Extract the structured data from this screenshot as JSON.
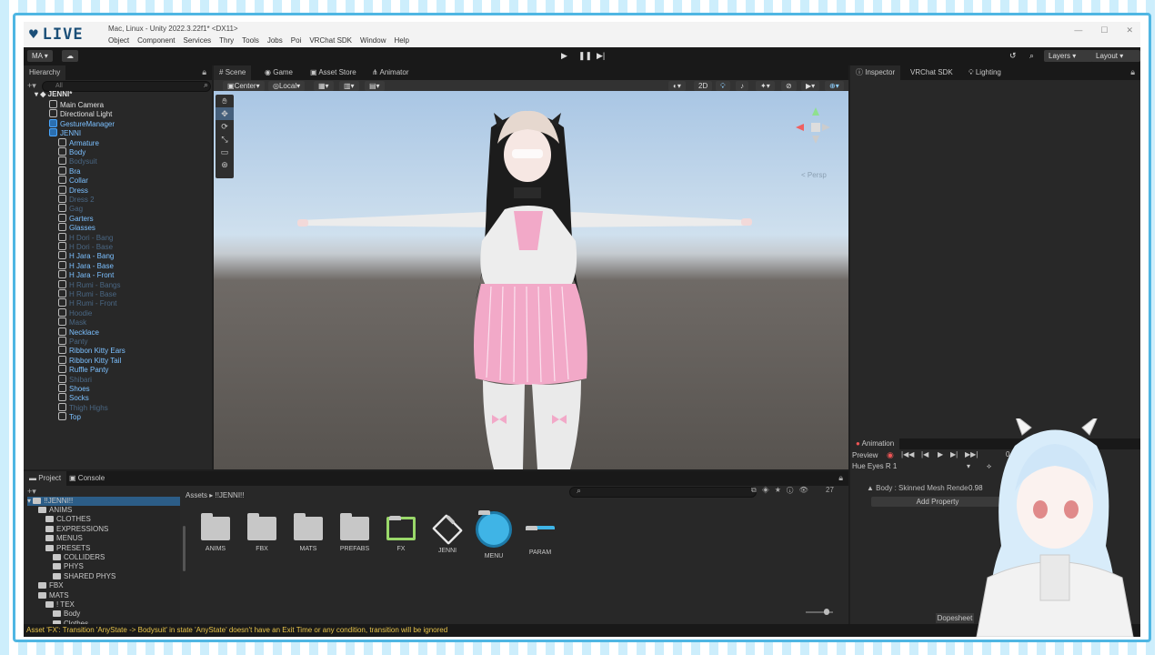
{
  "overlay": {
    "live_label": "LIVE"
  },
  "window": {
    "title": "Mac, Linux - Unity 2022.3.22f1* <DX11>",
    "menu": [
      "Object",
      "Component",
      "Services",
      "Thry",
      "Tools",
      "Jobs",
      "Poi",
      "VRChat SDK",
      "Window",
      "Help"
    ]
  },
  "toolbar": {
    "account": "MA",
    "layers": "Layers",
    "layout": "Layout"
  },
  "hierarchy": {
    "tab": "Hierarchy",
    "search_placeholder": "All",
    "root": "JENNI*",
    "items": [
      {
        "label": "Main Camera",
        "state": "white"
      },
      {
        "label": "Directional Light",
        "state": "white"
      },
      {
        "label": "GestureManager",
        "state": "active"
      },
      {
        "label": "JENNI",
        "state": "active"
      },
      {
        "label": "Armature",
        "state": "active"
      },
      {
        "label": "Body",
        "state": "active"
      },
      {
        "label": "Bodysuit",
        "state": "dim"
      },
      {
        "label": "Bra",
        "state": "active"
      },
      {
        "label": "Collar",
        "state": "active"
      },
      {
        "label": "Dress",
        "state": "active"
      },
      {
        "label": "Dress 2",
        "state": "dim"
      },
      {
        "label": "Gag",
        "state": "dim"
      },
      {
        "label": "Garters",
        "state": "active"
      },
      {
        "label": "Glasses",
        "state": "active"
      },
      {
        "label": "H Dori - Bang",
        "state": "dim"
      },
      {
        "label": "H Dori - Base",
        "state": "dim"
      },
      {
        "label": "H Jara - Bang",
        "state": "active"
      },
      {
        "label": "H Jara - Base",
        "state": "active"
      },
      {
        "label": "H Jara - Front",
        "state": "active"
      },
      {
        "label": "H Rumi - Bangs",
        "state": "dim"
      },
      {
        "label": "H Rumi - Base",
        "state": "dim"
      },
      {
        "label": "H Rumi - Front",
        "state": "dim"
      },
      {
        "label": "Hoodie",
        "state": "dim"
      },
      {
        "label": "Mask",
        "state": "dim"
      },
      {
        "label": "Necklace",
        "state": "active"
      },
      {
        "label": "Panty",
        "state": "dim"
      },
      {
        "label": "Ribbon Kitty Ears",
        "state": "active"
      },
      {
        "label": "Ribbon Kitty Tail",
        "state": "active"
      },
      {
        "label": "Ruffle Panty",
        "state": "active"
      },
      {
        "label": "Shibari",
        "state": "dim"
      },
      {
        "label": "Shoes",
        "state": "active"
      },
      {
        "label": "Socks",
        "state": "active"
      },
      {
        "label": "Thigh Highs",
        "state": "dim"
      },
      {
        "label": "Top",
        "state": "active"
      }
    ]
  },
  "scene": {
    "tabs": [
      "Scene",
      "Game",
      "Asset Store",
      "Animator"
    ],
    "pivot": "Center",
    "space": "Local",
    "mode_2d": "2D",
    "gizmo_label": "< Persp"
  },
  "inspector": {
    "tabs": [
      "Inspector",
      "VRChat SDK",
      "Lighting"
    ]
  },
  "animation": {
    "tab": "Animation",
    "preview": "Preview",
    "clip": "Hue Eyes R 1",
    "property": "Body : Skinned Mesh Rende",
    "property_value": "0.98",
    "add_property": "Add Property",
    "dopesheet": "Dopesheet",
    "frame": "0"
  },
  "project": {
    "tabs": [
      "Project",
      "Console"
    ],
    "tree_root": "!!JENNI!!",
    "tree": [
      {
        "label": "ANIMS",
        "depth": 1
      },
      {
        "label": "CLOTHES",
        "depth": 2
      },
      {
        "label": "EXPRESSIONS",
        "depth": 2
      },
      {
        "label": "MENUS",
        "depth": 2
      },
      {
        "label": "PRESETS",
        "depth": 2
      },
      {
        "label": "COLLIDERS",
        "depth": 3
      },
      {
        "label": "PHYS",
        "depth": 3
      },
      {
        "label": "SHARED PHYS",
        "depth": 3
      },
      {
        "label": "FBX",
        "depth": 1
      },
      {
        "label": "MATS",
        "depth": 1
      },
      {
        "label": "! TEX",
        "depth": 2
      },
      {
        "label": "Body",
        "depth": 3
      },
      {
        "label": "Clothes",
        "depth": 3
      }
    ],
    "breadcrumb": [
      "Assets",
      "!!JENNI!!"
    ],
    "count": "27",
    "assets": [
      {
        "label": "ANIMS",
        "icon": "folder-icon"
      },
      {
        "label": "FBX",
        "icon": "folder-icon"
      },
      {
        "label": "MATS",
        "icon": "folder-icon"
      },
      {
        "label": "PREFABS",
        "icon": "folder-icon"
      },
      {
        "label": "FX",
        "icon": "animator-controller-icon"
      },
      {
        "label": "JENNI",
        "icon": "prefab-icon"
      },
      {
        "label": "MENU",
        "icon": "expressions-menu-icon"
      },
      {
        "label": "PARAM",
        "icon": "parameters-icon"
      }
    ]
  },
  "status": {
    "message": "Asset 'FX': Transition 'AnyState -> Bodysuit' in state 'AnyState' doesn't have an Exit Time or any condition, transition will be ignored"
  },
  "colors": {
    "accent_blue": "#7cc0ff",
    "warning": "#e8c44a",
    "dress_pink": "#f2a9c8",
    "frame_blue": "#4fb6e3"
  }
}
